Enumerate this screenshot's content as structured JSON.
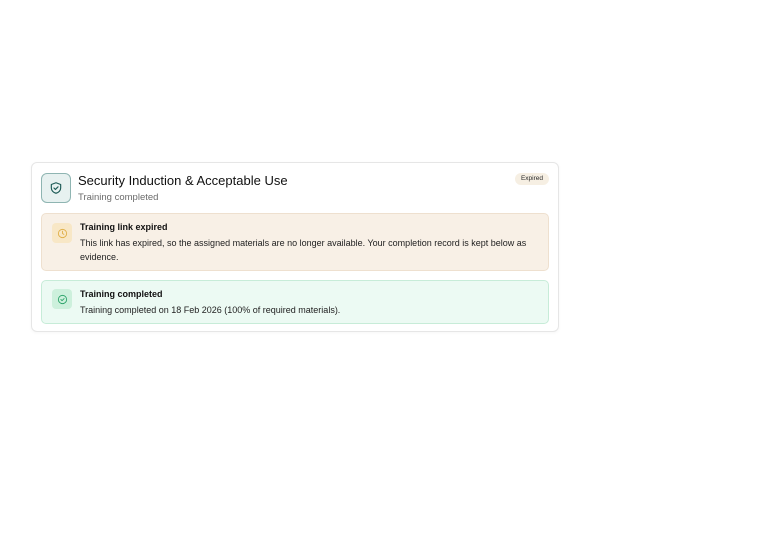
{
  "card": {
    "title": "Security Induction & Acceptable Use",
    "subtitle": "Training completed",
    "badge": "Expired",
    "icon": "shield-check-icon"
  },
  "expired_notice": {
    "title": "Training link expired",
    "text": "This link has expired, so the assigned materials are no longer available. Your completion record is kept below as evidence.",
    "icon": "clock-icon",
    "color": "#f8f0e6"
  },
  "completion_notice": {
    "title": "Training completed",
    "text": "Training completed on 18 Feb 2026 (100% of required materials).",
    "icon": "check-circle-icon",
    "color": "#ecfaf3"
  },
  "colors": {
    "accent": "#2e6f6a",
    "warning": "#e0b04a",
    "success": "#2fa56c"
  }
}
